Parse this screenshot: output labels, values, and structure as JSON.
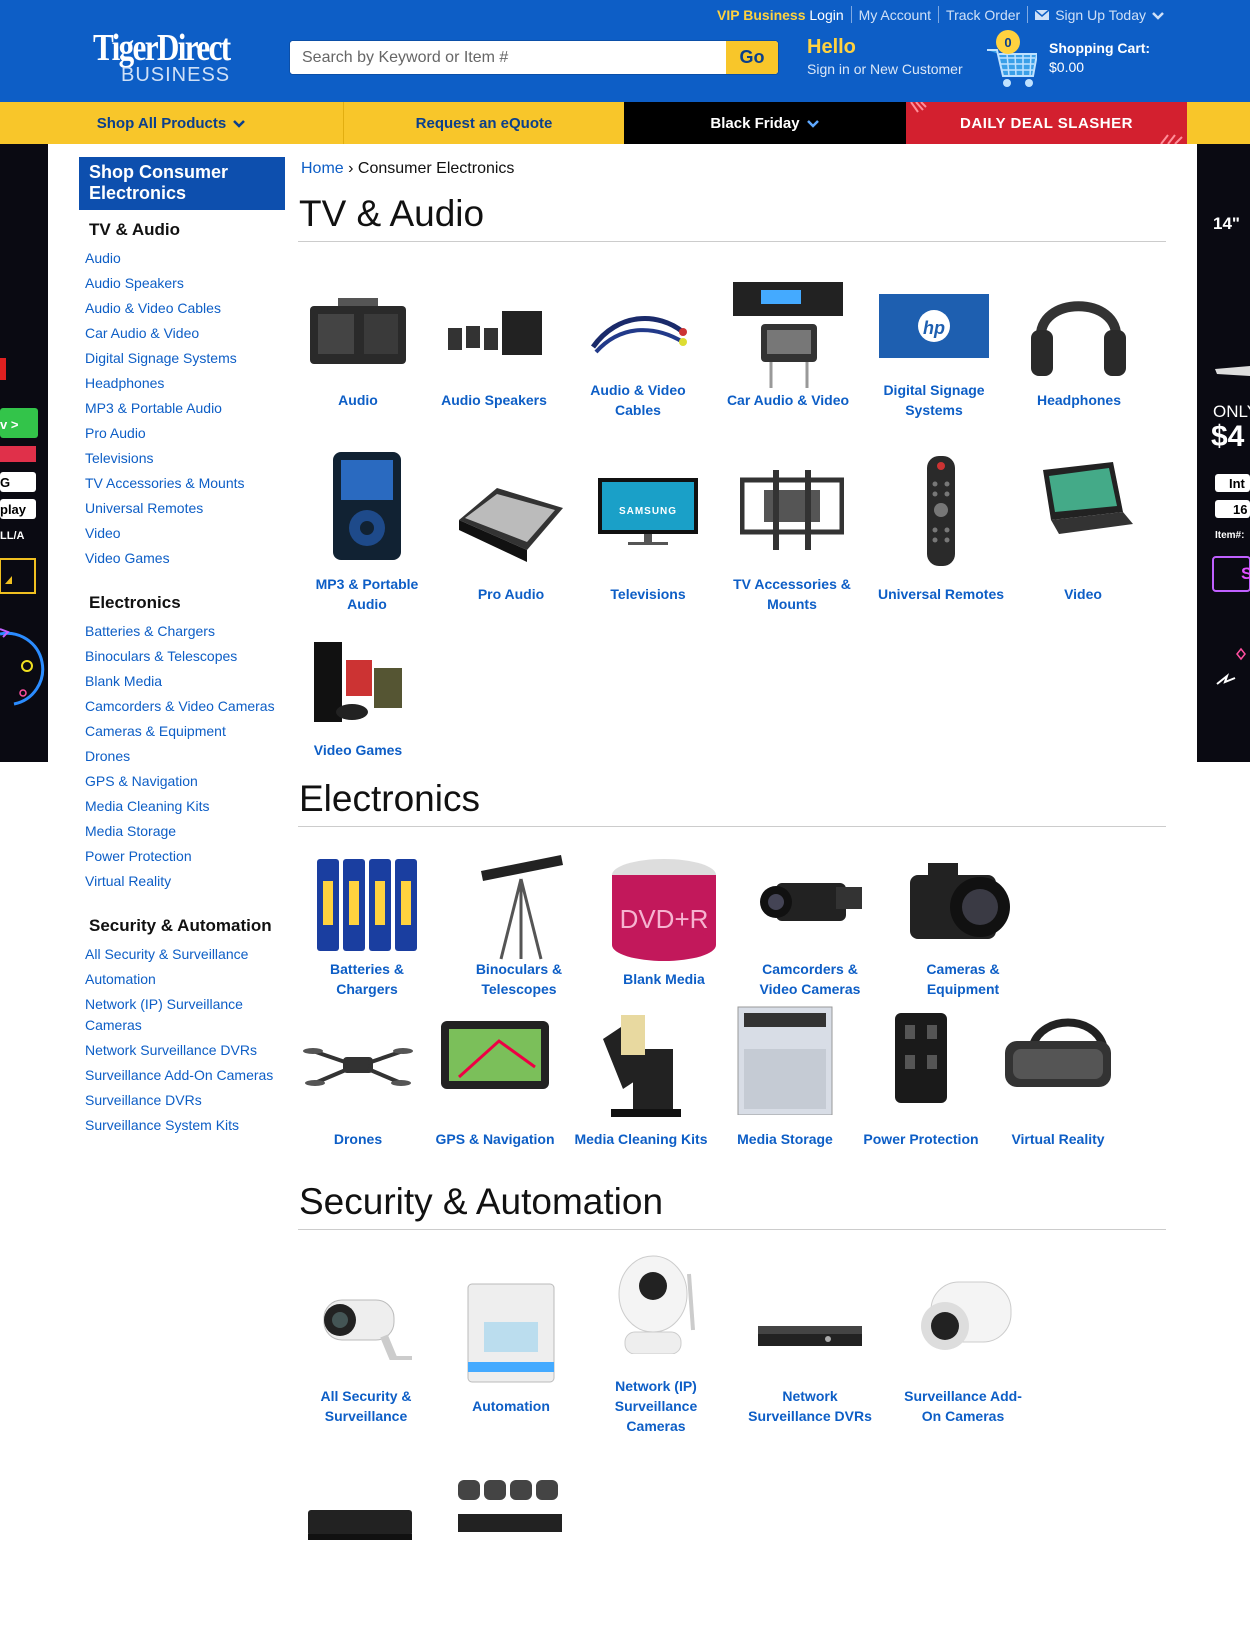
{
  "header": {
    "toplinks": {
      "vip": "VIP Business",
      "login": "Login",
      "my_account": "My Account",
      "track_order": "Track Order",
      "signup": "Sign Up Today"
    },
    "logo": {
      "line1": "TigerDirect",
      "line2": "BUSINESS"
    },
    "search": {
      "placeholder": "Search by Keyword or Item #",
      "go": "Go"
    },
    "hello": {
      "title": "Hello",
      "subtitle": "Sign in or New Customer"
    },
    "cart": {
      "count": "0",
      "label": "Shopping Cart:",
      "total": "$0.00"
    }
  },
  "nav": {
    "shop_all": "Shop All Products",
    "quote": "Request an eQuote",
    "black_friday": "Black Friday",
    "deal": "DAILY DEAL SLASHER"
  },
  "ads": {
    "right_texts": [
      "14\"",
      "ONLY",
      "$4",
      "Int",
      "16",
      "Item#:",
      "S"
    ],
    "left_texts": [
      "v >",
      "G",
      "play",
      "LL/A"
    ]
  },
  "sidebar": {
    "title": "Shop Consumer Electronics",
    "groups": [
      {
        "heading": "TV & Audio",
        "links": [
          "Audio",
          "Audio Speakers",
          "Audio & Video Cables",
          "Car Audio & Video",
          "Digital Signage Systems",
          "Headphones",
          "MP3 & Portable Audio",
          "Pro Audio",
          "Televisions",
          "TV Accessories & Mounts",
          "Universal Remotes",
          "Video",
          "Video Games"
        ]
      },
      {
        "heading": "Electronics",
        "links": [
          "Batteries & Chargers",
          "Binoculars & Telescopes",
          "Blank Media",
          "Camcorders & Video Cameras",
          "Cameras & Equipment",
          "Drones",
          "GPS & Navigation",
          "Media Cleaning Kits",
          "Media Storage",
          "Power Protection",
          "Virtual Reality"
        ]
      },
      {
        "heading": "Security & Automation",
        "links": [
          "All Security & Surveillance",
          "Automation",
          "Network (IP) Surveillance Cameras",
          "Network Surveillance DVRs",
          "Surveillance Add-On Cameras",
          "Surveillance DVRs",
          "Surveillance System Kits"
        ]
      }
    ]
  },
  "breadcrumb": {
    "home": "Home",
    "sep": "›",
    "current": "Consumer Electronics"
  },
  "sections": {
    "tv": {
      "title": "TV & Audio",
      "tiles": [
        "Audio",
        "Audio Speakers",
        "Audio & Video\nCables",
        "Car Audio & Video",
        "Digital Signage\nSystems",
        "Headphones",
        "MP3 & Portable\nAudio",
        "Pro Audio",
        "Televisions",
        "TV Accessories &\nMounts",
        "Universal Remotes",
        "Video",
        "Video Games"
      ]
    },
    "electronics": {
      "title": "Electronics",
      "tiles": [
        "Batteries &\nChargers",
        "Binoculars &\nTelescopes",
        "Blank Media",
        "Camcorders &\nVideo Cameras",
        "Cameras &\nEquipment",
        "Drones",
        "GPS & Navigation",
        "Media Cleaning Kits",
        "Media Storage",
        "Power Protection",
        "Virtual Reality"
      ]
    },
    "security": {
      "title": "Security & Automation",
      "tiles": [
        "All Security &\nSurveillance",
        "Automation",
        "Network (IP)\nSurveillance\nCameras",
        "Network\nSurveillance DVRs",
        "Surveillance Add-\nOn Cameras",
        "",
        ""
      ]
    }
  },
  "images": {
    "hp": "hp",
    "samsung": "SAMSUNG",
    "dvdr": "DVD+R"
  }
}
